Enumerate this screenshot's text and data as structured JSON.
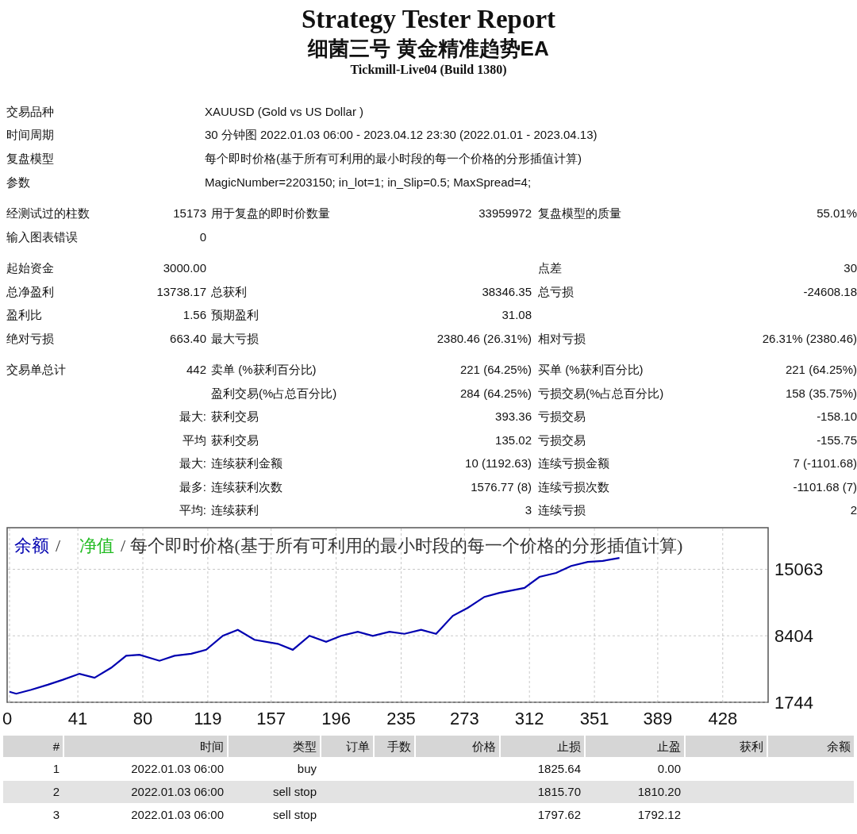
{
  "header": {
    "title": "Strategy Tester Report",
    "subtitle": "细菌三号 黄金精准趋势EA",
    "server": "Tickmill-Live04 (Build 1380)"
  },
  "info": [
    {
      "label": "交易品种",
      "value": "XAUUSD (Gold vs US Dollar )"
    },
    {
      "label": "时间周期",
      "value": "30 分钟图 2022.01.03 06:00 - 2023.04.12 23:30 (2022.01.01 - 2023.04.13)"
    },
    {
      "label": "复盘模型",
      "value": "每个即时价格(基于所有可利用的最小时段的每一个价格的分形插值计算)"
    },
    {
      "label": "参数",
      "value": "MagicNumber=2203150; in_lot=1; in_Slip=0.5; MaxSpread=4;"
    }
  ],
  "stat_groups": [
    [
      {
        "l1": "经测试过的柱数",
        "v1": "15173",
        "l2": "用于复盘的即时价数量",
        "v2": "33959972",
        "l3": "复盘模型的质量",
        "v3": "55.01%"
      },
      {
        "l1": "输入图表错误",
        "v1": "0"
      }
    ],
    [
      {
        "l1": "起始资金",
        "v1": "3000.00",
        "l3": "点差",
        "v3": "30"
      },
      {
        "l1": "总净盈利",
        "v1": "13738.17",
        "l2": "总获利",
        "v2": "38346.35",
        "l3": "总亏损",
        "v3": "-24608.18"
      },
      {
        "l1": "盈利比",
        "v1": "1.56",
        "l2": "预期盈利",
        "v2": "31.08"
      },
      {
        "l1": "绝对亏损",
        "v1": "663.40",
        "l2": "最大亏损",
        "v2": "2380.46 (26.31%)",
        "l3": "相对亏损",
        "v3": "26.31% (2380.46)"
      }
    ],
    [
      {
        "l1": "交易单总计",
        "v1": "442",
        "l2": "卖单 (%获利百分比)",
        "v2": "221 (64.25%)",
        "l3": "买单 (%获利百分比)",
        "v3": "221 (64.25%)"
      },
      {
        "l2": "盈利交易(%占总百分比)",
        "v2": "284 (64.25%)",
        "l3": "亏损交易(%占总百分比)",
        "v3": "158 (35.75%)"
      },
      {
        "v1": "最大:",
        "l2": "获利交易",
        "v2": "393.36",
        "l3": "亏损交易",
        "v3": "-158.10"
      },
      {
        "v1": "平均",
        "l2": "获利交易",
        "v2": "135.02",
        "l3": "亏损交易",
        "v3": "-155.75"
      },
      {
        "v1": "最大:",
        "l2": "连续获利金额",
        "v2": "10 (1192.63)",
        "l3": "连续亏损金额",
        "v3": "7 (-1101.68)"
      },
      {
        "v1": "最多:",
        "l2": "连续获利次数",
        "v2": "1576.77 (8)",
        "l3": "连续亏损次数",
        "v3": "-1101.68 (7)"
      },
      {
        "v1": "平均:",
        "l2": "连续获利",
        "v2": "3",
        "l3": "连续亏损",
        "v3": "2"
      }
    ]
  ],
  "chart": {
    "legend": [
      {
        "text": "/"
      },
      {
        "text": "净值",
        "color": "#22bb22"
      },
      {
        "text": "/ 每个即时价格(基于所有可利用的最小时段的每一个价格的分形插值计算)"
      }
    ],
    "chart_data": {
      "type": "line",
      "grid": true,
      "x": [
        0,
        4,
        13,
        23,
        32,
        42,
        51,
        61,
        70,
        78,
        90,
        99,
        109,
        118,
        128,
        137,
        147,
        161,
        170,
        180,
        190,
        199,
        209,
        218,
        228,
        237,
        247,
        256,
        266,
        275,
        285,
        294,
        309,
        318,
        328,
        337,
        347,
        356,
        366
      ],
      "series": [
        {
          "name": "余额",
          "color": "#0000b0",
          "values": [
            2800,
            2600,
            3000,
            3500,
            4000,
            4600,
            4200,
            5200,
            6400,
            6500,
            5900,
            6400,
            6600,
            7000,
            8400,
            9000,
            8000,
            7600,
            7000,
            8400,
            7800,
            8400,
            8800,
            8400,
            8800,
            8600,
            9000,
            8600,
            10400,
            11200,
            12300,
            12700,
            13200,
            14300,
            14700,
            15400,
            15800,
            15900,
            16200
          ]
        }
      ],
      "xlim": [
        0,
        455
      ],
      "ylim": [
        1744,
        19230
      ],
      "xticks": [
        0,
        41,
        80,
        119,
        157,
        196,
        235,
        273,
        312,
        351,
        389,
        428
      ],
      "yticks": [
        1744,
        8404,
        15063
      ]
    }
  },
  "table": {
    "columns": [
      "#",
      "时间",
      "类型",
      "订单",
      "手数",
      "价格",
      "止损",
      "止盈",
      "获利",
      "余额"
    ],
    "rows": [
      [
        "1",
        "2022.01.03 06:00",
        "buy",
        null,
        null,
        null,
        "1825.64",
        "0.00",
        null,
        null
      ],
      [
        "2",
        "2022.01.03 06:00",
        "sell stop",
        null,
        null,
        null,
        "1815.70",
        "1810.20",
        null,
        null
      ],
      [
        "3",
        "2022.01.03 06:00",
        "sell stop",
        null,
        null,
        null,
        "1797.62",
        "1792.12",
        null,
        null
      ]
    ]
  }
}
